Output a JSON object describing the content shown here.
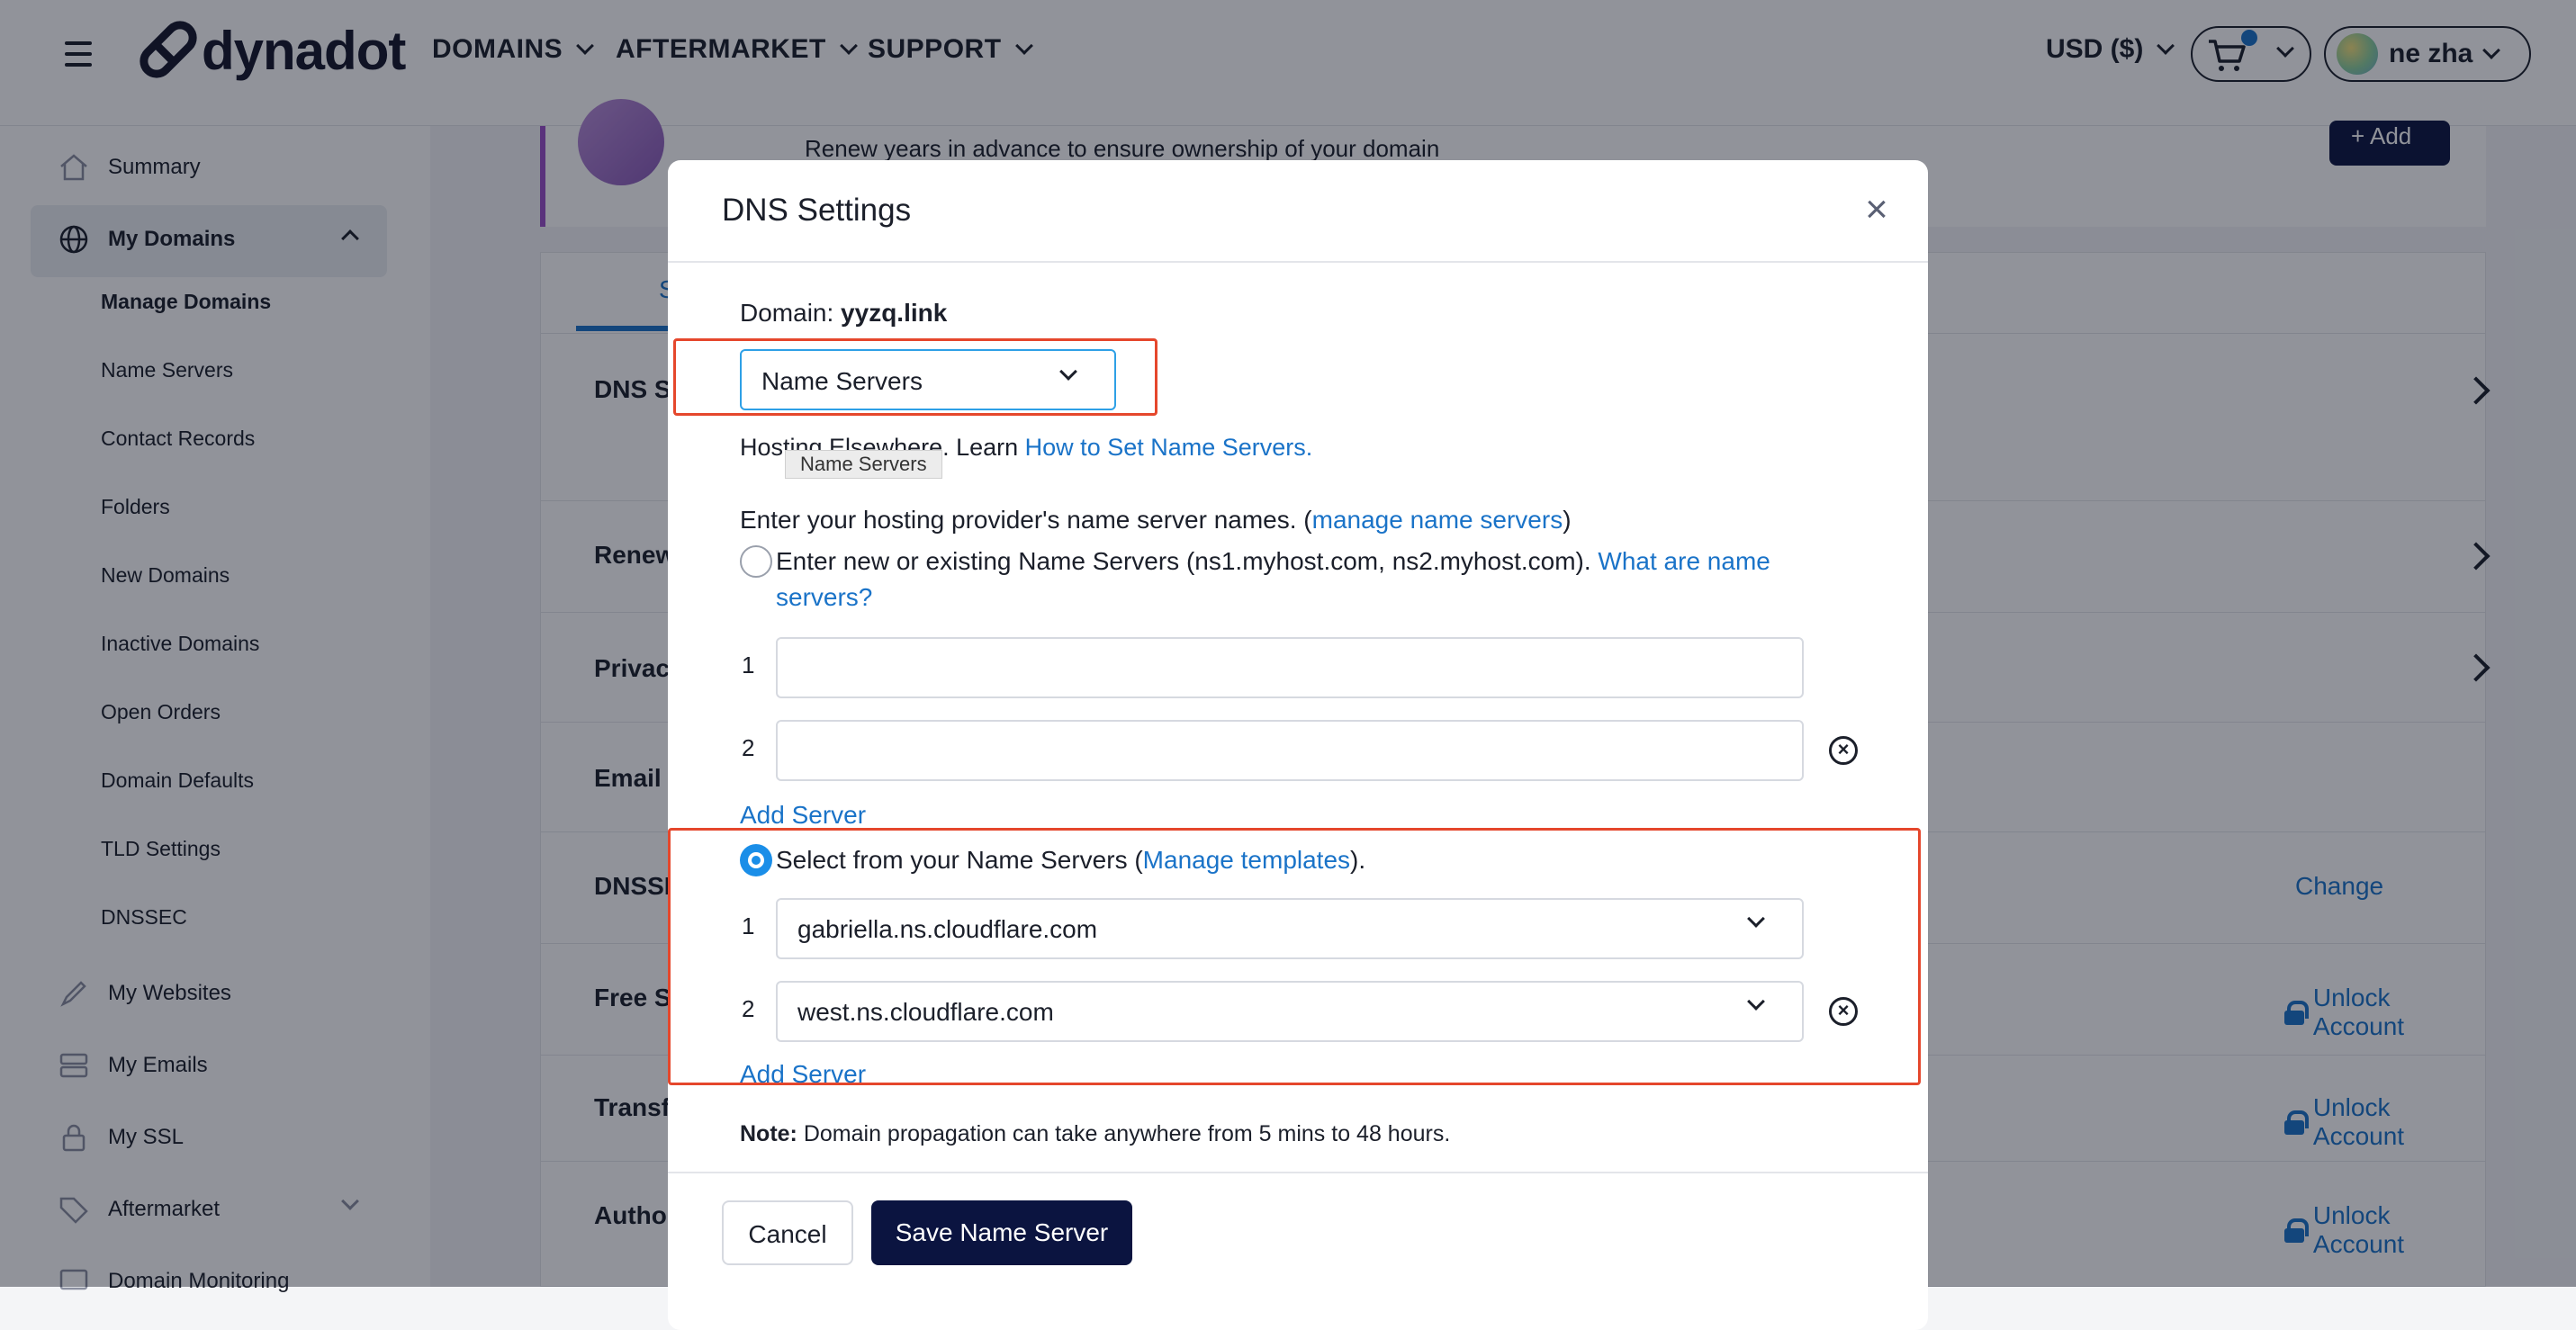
{
  "header": {
    "logo": "dynadot",
    "nav": [
      "DOMAINS",
      "AFTERMARKET",
      "SUPPORT"
    ],
    "currency": "USD ($)",
    "user_name": "ne zha",
    "accent_color": "#1a73c8"
  },
  "sidebar": {
    "summary": "Summary",
    "my_domains": "My Domains",
    "sub_items": [
      "Manage Domains",
      "Name Servers",
      "Contact Records",
      "Folders",
      "New Domains",
      "Inactive Domains",
      "Open Orders",
      "Domain Defaults",
      "TLD Settings",
      "DNSSEC"
    ],
    "my_websites": "My Websites",
    "my_emails": "My Emails",
    "my_ssl": "My SSL",
    "aftermarket": "Aftermarket",
    "domain_monitoring": "Domain Monitoring"
  },
  "main": {
    "renew_text": "Renew years in advance to ensure ownership of your domain",
    "add_label": "+ Add",
    "tab_label": "S",
    "rows": {
      "dns": "DNS Se",
      "renew": "Renew",
      "privacy": "Privac",
      "email": "Email S",
      "dnssec": "DNSSE",
      "free": "Free S",
      "transfer": "Transf",
      "auth": "Author"
    },
    "change_label": "Change",
    "unlock_label": "Unlock Account"
  },
  "modal": {
    "title": "DNS Settings",
    "close": "×",
    "domain_label": "Domain:",
    "domain_value": "yyzq.link",
    "selected_type": "Name Servers",
    "hosting_prefix": "Hosting Elsewhere. Learn ",
    "hosting_link": "How to Set Name Servers.",
    "tooltip": "Name Servers",
    "instr_prefix": "Enter your hosting provider's name server names. (",
    "instr_link": "manage name servers",
    "instr_suffix": ")",
    "option1_text": "Enter new or existing Name Servers (ns1.myhost.com, ns2.myhost.com). ",
    "option1_link": "What are name servers?",
    "num1": "1",
    "num2": "2",
    "add_server": "Add Server",
    "option2_prefix": "Select from your Name Servers (",
    "option2_link": "Manage templates",
    "option2_suffix": ").",
    "ns1": "gabriella.ns.cloudflare.com",
    "ns2": "west.ns.cloudflare.com",
    "note_label": "Note:",
    "note_text": " Domain propagation can take anywhere from 5 mins to 48 hours.",
    "cancel": "Cancel",
    "save": "Save Name Server"
  }
}
